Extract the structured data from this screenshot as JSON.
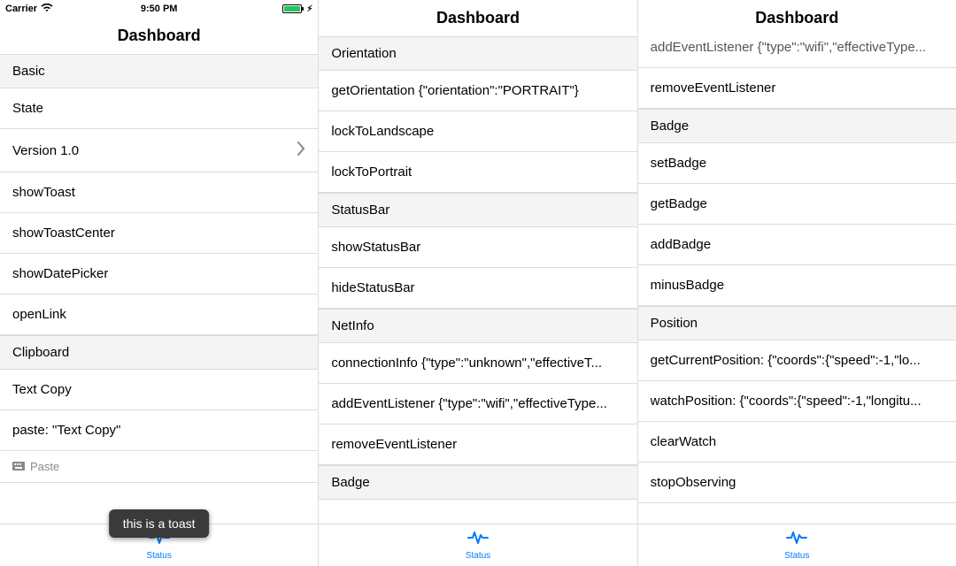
{
  "statusbar": {
    "carrier": "Carrier",
    "time": "9:50 PM"
  },
  "tab": {
    "label": "Status"
  },
  "toast": {
    "text": "this is a toast"
  },
  "pane1": {
    "title": "Dashboard",
    "sections": {
      "basic": "Basic",
      "clipboard": "Clipboard"
    },
    "rows": {
      "state": "State",
      "version": "Version 1.0",
      "showToast": "showToast",
      "showToastCenter": "showToastCenter",
      "showDatePicker": "showDatePicker",
      "openLink": "openLink",
      "textCopy": "Text Copy",
      "paste": "paste: \"Text Copy\"",
      "pasteHint": "Paste"
    }
  },
  "pane2": {
    "title": "Dashboard",
    "sections": {
      "orientation": "Orientation",
      "statusBar": "StatusBar",
      "netInfo": "NetInfo",
      "badge": "Badge"
    },
    "rows": {
      "getOrientation": "getOrientation {\"orientation\":\"PORTRAIT\"}",
      "lockToLandscape": "lockToLandscape",
      "lockToPortrait": "lockToPortrait",
      "showStatusBar": "showStatusBar",
      "hideStatusBar": "hideStatusBar",
      "connectionInfo": "connectionInfo {\"type\":\"unknown\",\"effectiveT...",
      "addEventListener": "addEventListener {\"type\":\"wifi\",\"effectiveType...",
      "removeEventListener": "removeEventListener"
    }
  },
  "pane3": {
    "title": "Dashboard",
    "sections": {
      "badge": "Badge",
      "position": "Position"
    },
    "rows": {
      "partialTop": "addEventListener {\"type\":\"wifi\",\"effectiveType...",
      "removeEventListener": "removeEventListener",
      "setBadge": "setBadge",
      "getBadge": "getBadge",
      "addBadge": "addBadge",
      "minusBadge": "minusBadge",
      "getCurrentPosition": "getCurrentPosition: {\"coords\":{\"speed\":-1,\"lo...",
      "watchPosition": "watchPosition: {\"coords\":{\"speed\":-1,\"longitu...",
      "clearWatch": "clearWatch",
      "stopObserving": "stopObserving"
    }
  }
}
